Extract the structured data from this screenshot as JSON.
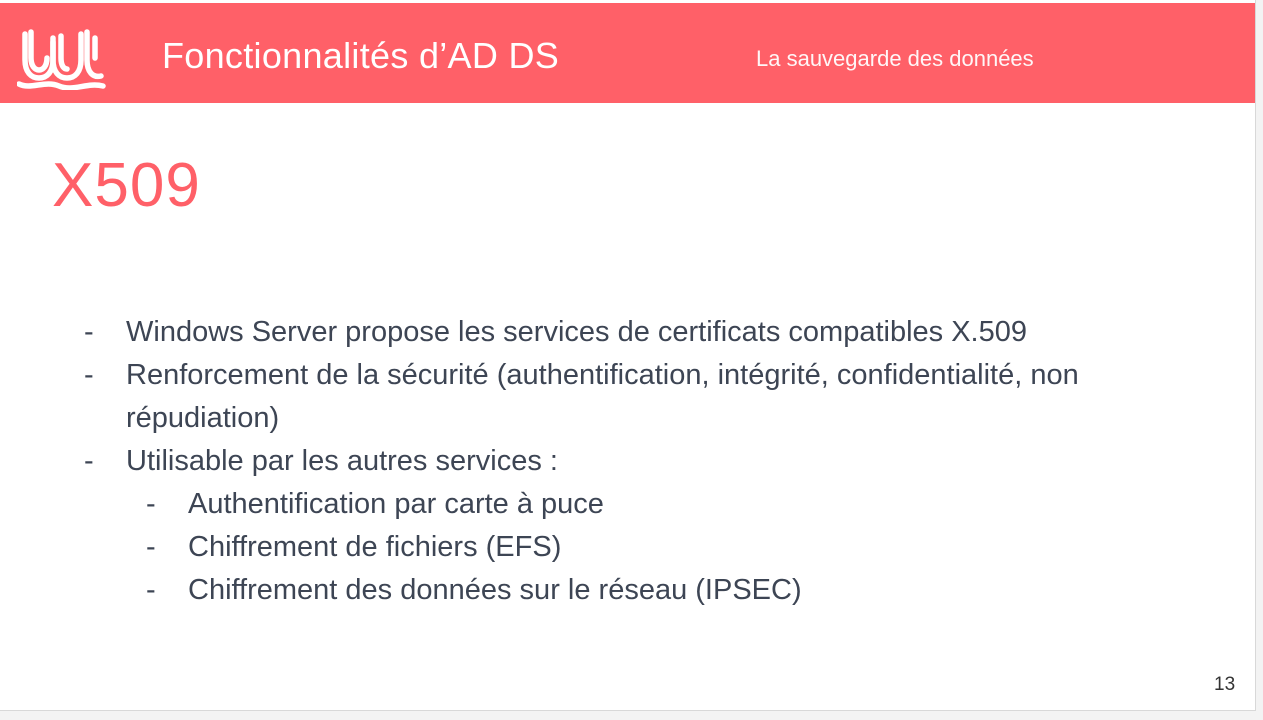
{
  "header": {
    "title": "Fonctionnalités d’AD DS",
    "subtitle": "La sauvegarde des données",
    "logo_icon": "wavy-logo-icon",
    "background_color": "#ff6068"
  },
  "slide": {
    "title": "X509",
    "title_color": "#ff6068",
    "bullet_marker": "-",
    "bullets": [
      {
        "text": "Windows Server propose les services de certificats compatibles X.509"
      },
      {
        "text": "Renforcement de la sécurité (authentification, intégrité, confidentialité, non répudiation)"
      },
      {
        "text": "Utilisable par les autres services :",
        "sub": [
          {
            "text": "Authentification par carte à puce"
          },
          {
            "text": "Chiffrement de fichiers (EFS)"
          },
          {
            "text": "Chiffrement des données sur le réseau (IPSEC)"
          }
        ]
      }
    ]
  },
  "page_number": "13"
}
